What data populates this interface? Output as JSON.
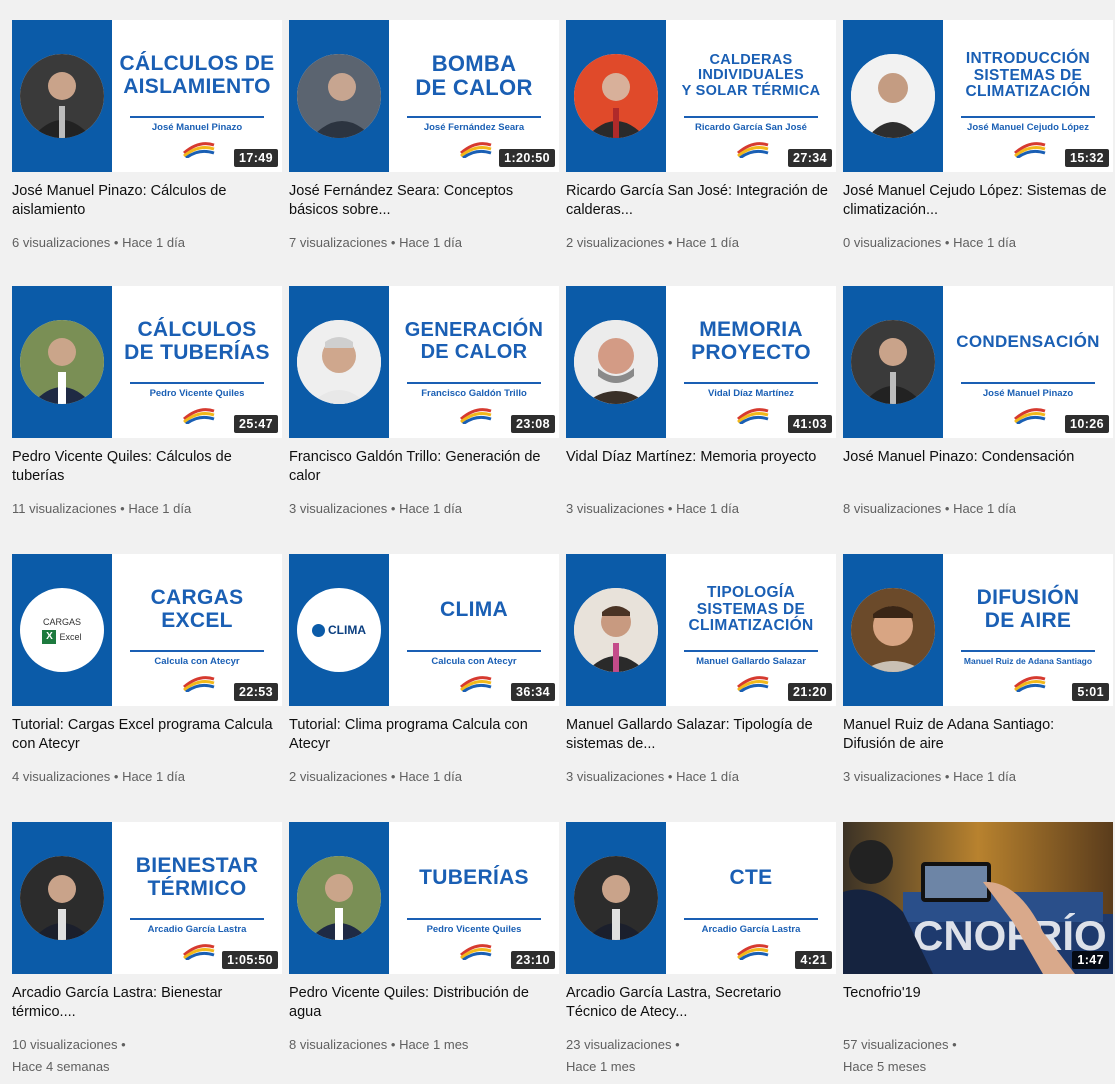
{
  "colors": {
    "brand_blue": "#0b5ba8",
    "title_blue": "#1a5fb4",
    "meta_gray": "#606060"
  },
  "videos": [
    {
      "thumb_title": "CÁLCULOS DE\nAISLAMIENTO",
      "speaker": "José Manuel Pinazo",
      "duration": "17:49",
      "title": "José Manuel Pinazo: Cálculos de aislamiento",
      "views": "6 visualizaciones",
      "age": "Hace 1 día",
      "avatar_icon": "speaker-portrait-icon"
    },
    {
      "thumb_title": "BOMBA\nDE CALOR",
      "speaker": "José Fernández Seara",
      "duration": "1:20:50",
      "title": "José Fernández Seara: Conceptos básicos sobre...",
      "views": "7 visualizaciones",
      "age": "Hace 1 día",
      "avatar_icon": "speaker-portrait-icon"
    },
    {
      "thumb_title": "CALDERAS\nINDIVIDUALES\nY SOLAR TÉRMICA",
      "speaker": "Ricardo García San José",
      "duration": "27:34",
      "title": "Ricardo García San José: Integración de calderas...",
      "views": "2 visualizaciones",
      "age": "Hace 1 día",
      "avatar_icon": "speaker-portrait-icon"
    },
    {
      "thumb_title": "INTRODUCCIÓN\nSISTEMAS DE\nCLIMATIZACIÓN",
      "speaker": "José Manuel Cejudo López",
      "duration": "15:32",
      "title": "José Manuel Cejudo López: Sistemas de climatización...",
      "views": "0 visualizaciones",
      "age": "Hace 1 día",
      "avatar_icon": "speaker-portrait-icon"
    },
    {
      "thumb_title": "CÁLCULOS\nDE TUBERÍAS",
      "speaker": "Pedro Vicente Quiles",
      "duration": "25:47",
      "title": "Pedro Vicente Quiles: Cálculos de tuberías",
      "views": "11 visualizaciones",
      "age": "Hace 1 día",
      "avatar_icon": "speaker-portrait-icon"
    },
    {
      "thumb_title": "GENERACIÓN\nDE CALOR",
      "speaker": "Francisco Galdón Trillo",
      "duration": "23:08",
      "title": "Francisco Galdón Trillo: Generación de calor",
      "views": "3 visualizaciones",
      "age": "Hace 1 día",
      "avatar_icon": "speaker-portrait-icon"
    },
    {
      "thumb_title": "MEMORIA\nPROYECTO",
      "speaker": "Vidal Díaz Martínez",
      "duration": "41:03",
      "title": "Vidal Díaz Martínez: Memoria proyecto",
      "views": "3 visualizaciones",
      "age": "Hace 1 día",
      "avatar_icon": "speaker-portrait-icon"
    },
    {
      "thumb_title": "CONDENSACIÓN",
      "speaker": "José Manuel Pinazo",
      "duration": "10:26",
      "title": "José Manuel Pinazo: Condensación",
      "views": "8 visualizaciones",
      "age": "Hace 1 día",
      "avatar_icon": "speaker-portrait-icon"
    },
    {
      "thumb_title": "CARGAS\nEXCEL",
      "speaker": "Calcula con Atecyr",
      "duration": "22:53",
      "title": "Tutorial: Cargas Excel programa Calcula con Atecyr",
      "views": "4 visualizaciones",
      "age": "Hace 1 día",
      "avatar_icon": "excel-logo-icon",
      "logo_top": "CARGAS",
      "logo_bottom": "Excel"
    },
    {
      "thumb_title": "CLIMA",
      "speaker": "Calcula con Atecyr",
      "duration": "36:34",
      "title": "Tutorial: Clima programa Calcula con Atecyr",
      "views": "2 visualizaciones",
      "age": "Hace 1 día",
      "avatar_icon": "clima-logo-icon",
      "logo_text": "CLIMA"
    },
    {
      "thumb_title": "TIPOLOGÍA\nSISTEMAS DE\nCLIMATIZACIÓN",
      "speaker": "Manuel Gallardo Salazar",
      "duration": "21:20",
      "title": "Manuel Gallardo Salazar: Tipología de sistemas de...",
      "views": "3 visualizaciones",
      "age": "Hace 1 día",
      "avatar_icon": "speaker-portrait-icon"
    },
    {
      "thumb_title": "DIFUSIÓN\nDE AIRE",
      "speaker": "Manuel Ruiz de Adana Santiago",
      "duration": "5:01",
      "title": "Manuel Ruiz de Adana Santiago: Difusión de aire",
      "views": "3 visualizaciones",
      "age": "Hace 1 día",
      "avatar_icon": "speaker-portrait-icon"
    },
    {
      "thumb_title": "BIENESTAR\nTÉRMICO",
      "speaker": "Arcadio García Lastra",
      "duration": "1:05:50",
      "title": "Arcadio García Lastra: Bienestar térmico....",
      "views": "10 visualizaciones •",
      "age": "Hace 4 semanas",
      "avatar_icon": "speaker-portrait-icon"
    },
    {
      "thumb_title": "TUBERÍAS",
      "speaker": "Pedro Vicente Quiles",
      "duration": "23:10",
      "title": "Pedro Vicente Quiles: Distribución de agua",
      "views": "8 visualizaciones",
      "age": "Hace 1 mes",
      "avatar_icon": "speaker-portrait-icon"
    },
    {
      "thumb_title": "CTE",
      "speaker": "Arcadio García Lastra",
      "duration": "4:21",
      "title": "Arcadio García Lastra, Secretario Técnico de Atecy...",
      "views": "23 visualizaciones •",
      "age": "Hace 1 mes",
      "avatar_icon": "speaker-portrait-icon"
    },
    {
      "thumb_title": "",
      "speaker": "",
      "duration": "1:47",
      "title": "Tecnofrio'19",
      "views": "57 visualizaciones •",
      "age": "Hace 5 meses",
      "avatar_icon": "event-photo-icon",
      "photo_text": "CNOFRÍO"
    }
  ]
}
